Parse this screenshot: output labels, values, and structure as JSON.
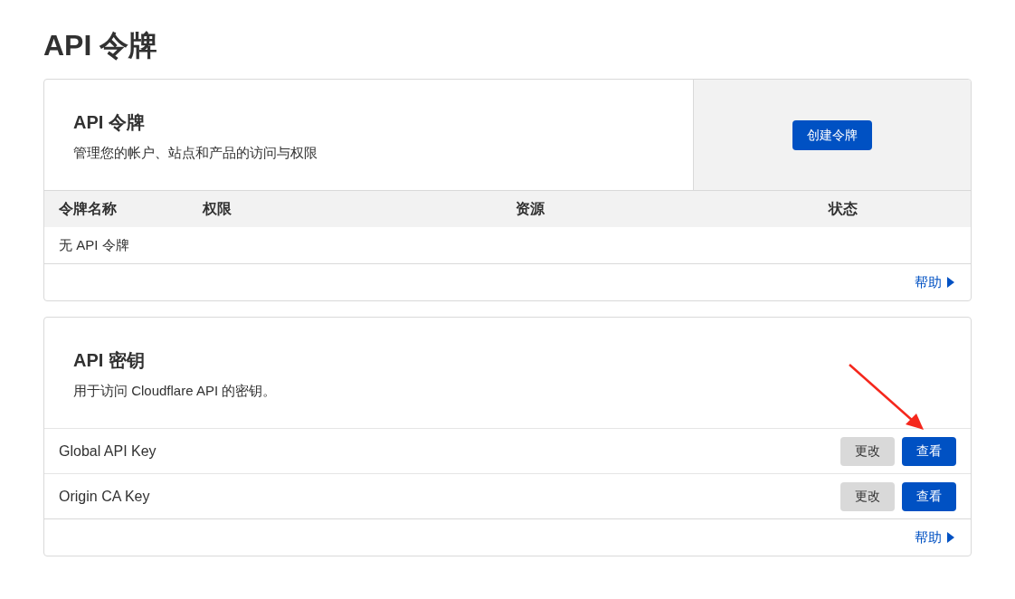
{
  "page_title": "API 令牌",
  "tokens_card": {
    "title": "API 令牌",
    "description": "管理您的帐户、站点和产品的访问与权限",
    "create_button": "创建令牌",
    "table": {
      "columns": [
        "令牌名称",
        "权限",
        "资源",
        "状态"
      ],
      "empty_message": "无 API 令牌"
    },
    "help_link": "帮助"
  },
  "keys_card": {
    "title": "API 密钥",
    "description": "用于访问 Cloudflare API 的密钥。",
    "rows": [
      {
        "name": "Global API Key",
        "change_button": "更改",
        "view_button": "查看"
      },
      {
        "name": "Origin CA Key",
        "change_button": "更改",
        "view_button": "查看"
      }
    ],
    "help_link": "帮助"
  }
}
